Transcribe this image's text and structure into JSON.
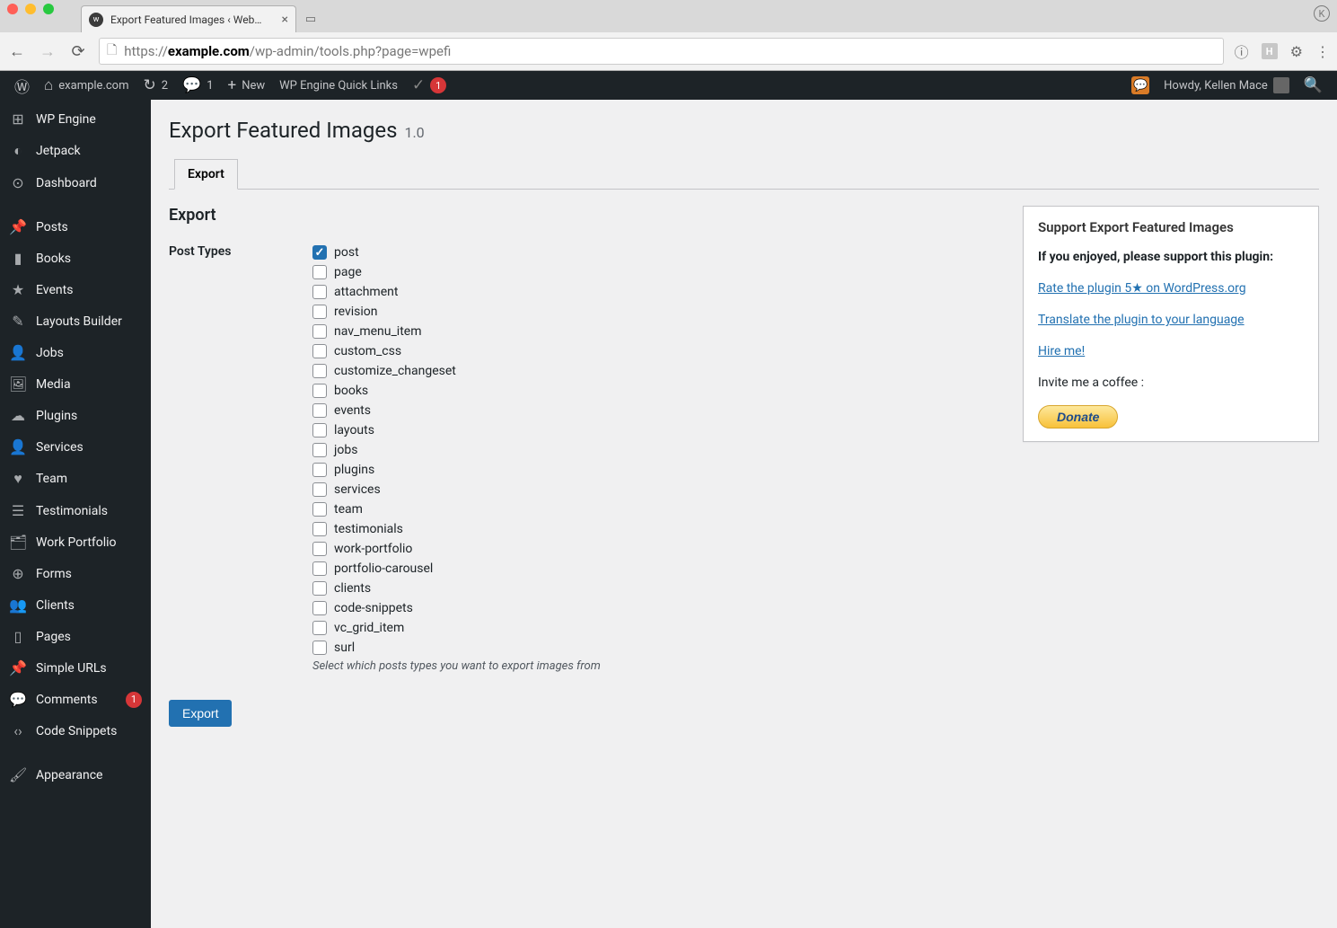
{
  "browser": {
    "tab_title": "Export Featured Images ‹ Web…",
    "url_host": "example.com",
    "url_path": "/wp-admin/tools.php?page=wpefi",
    "profile_letter": "K",
    "ext_h": "H"
  },
  "adminbar": {
    "site_name": "example.com",
    "updates_count": "2",
    "comments_count": "1",
    "new_label": "New",
    "quicklinks_label": "WP Engine Quick Links",
    "yoast_badge": "1",
    "howdy": "Howdy, Kellen Mace"
  },
  "sidebar": {
    "items": [
      {
        "label": "WP Engine",
        "icon": "⊞"
      },
      {
        "label": "Jetpack",
        "icon": "◐"
      },
      {
        "label": "Dashboard",
        "icon": "⊙"
      },
      {
        "sep": true
      },
      {
        "label": "Posts",
        "icon": "📌"
      },
      {
        "label": "Books",
        "icon": "▮"
      },
      {
        "label": "Events",
        "icon": "★"
      },
      {
        "label": "Layouts Builder",
        "icon": "✎"
      },
      {
        "label": "Jobs",
        "icon": "👤"
      },
      {
        "label": "Media",
        "icon": "🖼"
      },
      {
        "label": "Plugins",
        "icon": "☁"
      },
      {
        "label": "Services",
        "icon": "👤"
      },
      {
        "label": "Team",
        "icon": "♥"
      },
      {
        "label": "Testimonials",
        "icon": "☰"
      },
      {
        "label": "Work Portfolio",
        "icon": "🗂"
      },
      {
        "label": "Forms",
        "icon": "⊕"
      },
      {
        "label": "Clients",
        "icon": "👥"
      },
      {
        "label": "Pages",
        "icon": "▯"
      },
      {
        "label": "Simple URLs",
        "icon": "📌"
      },
      {
        "label": "Comments",
        "icon": "💬",
        "badge": "1"
      },
      {
        "label": "Code Snippets",
        "icon": "‹›"
      },
      {
        "sep": true
      },
      {
        "label": "Appearance",
        "icon": "🖌"
      }
    ]
  },
  "page": {
    "title": "Export Featured Images",
    "version": "1.0",
    "tab_label": "Export",
    "section_heading": "Export",
    "post_types_label": "Post Types",
    "post_types": [
      {
        "name": "post",
        "checked": true
      },
      {
        "name": "page",
        "checked": false
      },
      {
        "name": "attachment",
        "checked": false
      },
      {
        "name": "revision",
        "checked": false
      },
      {
        "name": "nav_menu_item",
        "checked": false
      },
      {
        "name": "custom_css",
        "checked": false
      },
      {
        "name": "customize_changeset",
        "checked": false
      },
      {
        "name": "books",
        "checked": false
      },
      {
        "name": "events",
        "checked": false
      },
      {
        "name": "layouts",
        "checked": false
      },
      {
        "name": "jobs",
        "checked": false
      },
      {
        "name": "plugins",
        "checked": false
      },
      {
        "name": "services",
        "checked": false
      },
      {
        "name": "team",
        "checked": false
      },
      {
        "name": "testimonials",
        "checked": false
      },
      {
        "name": "work-portfolio",
        "checked": false
      },
      {
        "name": "portfolio-carousel",
        "checked": false
      },
      {
        "name": "clients",
        "checked": false
      },
      {
        "name": "code-snippets",
        "checked": false
      },
      {
        "name": "vc_grid_item",
        "checked": false
      },
      {
        "name": "surl",
        "checked": false
      }
    ],
    "post_types_desc": "Select which posts types you want to export images from",
    "submit_label": "Export"
  },
  "support_box": {
    "heading": "Support Export Featured Images",
    "intro": "If you enjoyed, please support this plugin:",
    "link_rate": "Rate the plugin 5★ on WordPress.org",
    "link_translate": "Translate the plugin to your language",
    "link_hire": "Hire me!",
    "coffee": "Invite me a coffee :",
    "donate_label": "Donate"
  }
}
